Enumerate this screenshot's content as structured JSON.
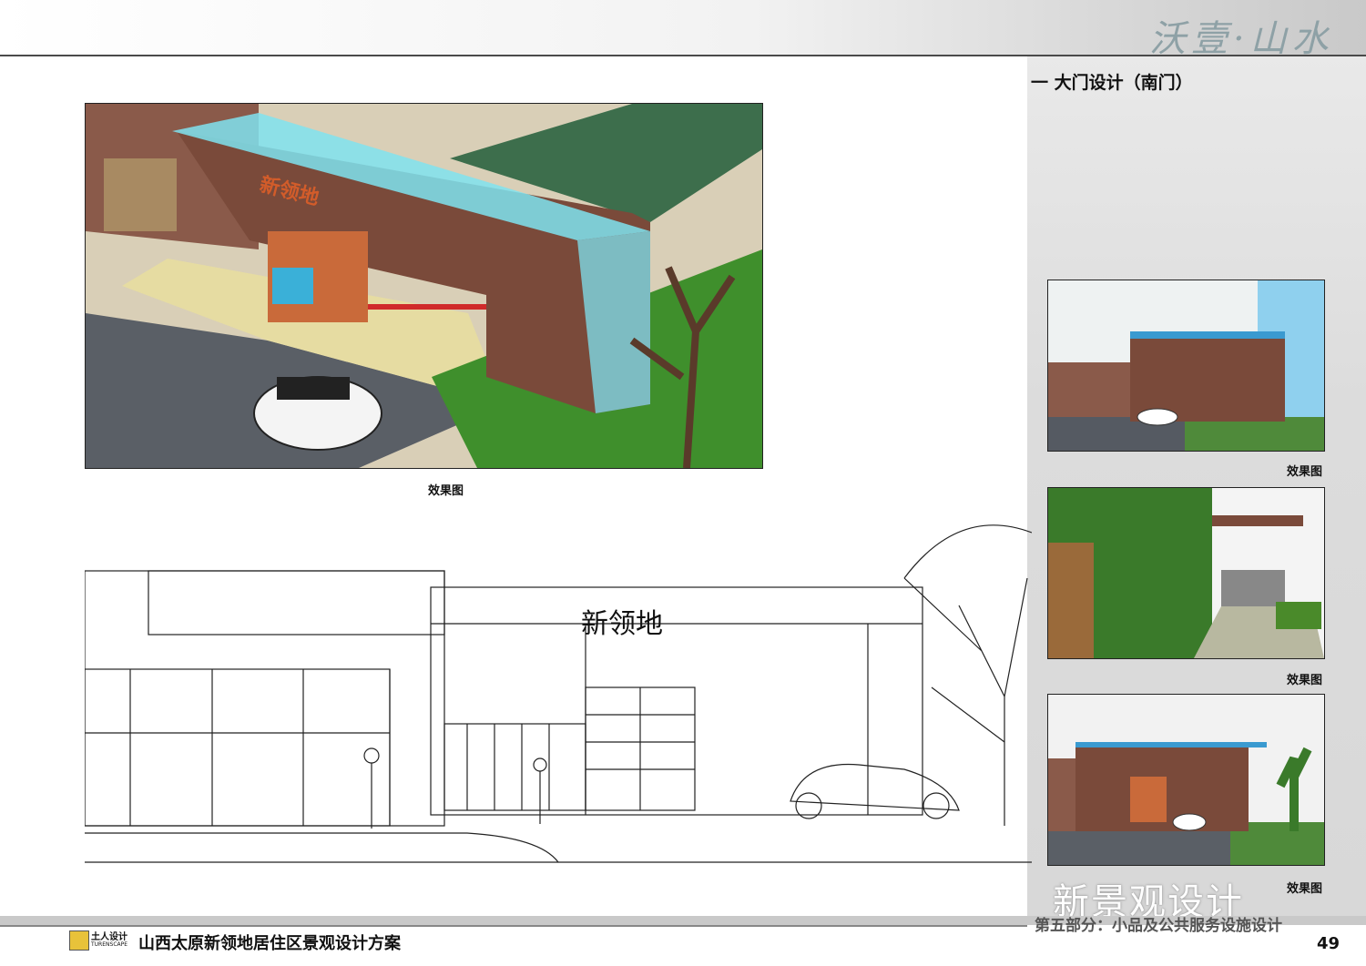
{
  "header": {
    "brand_script": "沃壹·山水",
    "section_title": "一  大门设计（南门）"
  },
  "images": {
    "main_render": {
      "caption": "效果图"
    },
    "thumb1": {
      "caption": "效果图"
    },
    "thumb2": {
      "caption": "效果图"
    },
    "thumb3": {
      "caption": "效果图"
    }
  },
  "render_sign": "新领地",
  "footer": {
    "logo_cn": "土人设计",
    "logo_en": "TURENSCAPE",
    "project_title": "山西太原新领地居住区景观设计方案",
    "part_title": "第五部分：小品及公共服务设施设计",
    "page_number": "49"
  },
  "watermark": "新景观设计",
  "colors": {
    "brick": "#7a4a3a",
    "glass": "#7fe3f0",
    "grass": "#3c8a2a",
    "sidebar_bg": "#dcdcdc"
  }
}
